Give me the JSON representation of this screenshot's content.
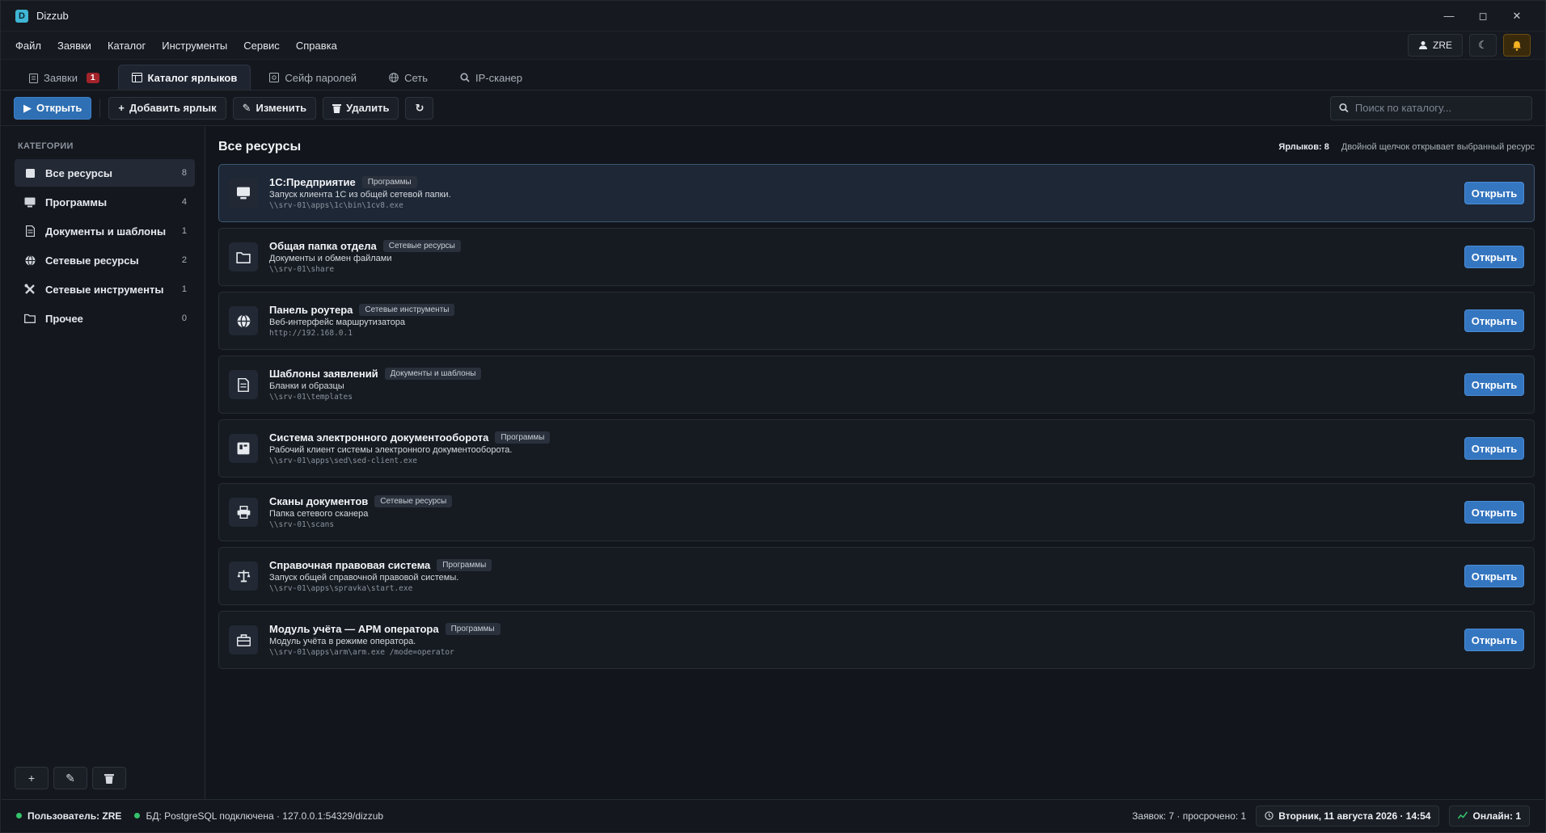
{
  "window": {
    "title": "Dizzub",
    "logo_letter": "D",
    "controls": [
      "—",
      "◻",
      "✕"
    ]
  },
  "menu": [
    "Файл",
    "Заявки",
    "Каталог",
    "Инструменты",
    "Сервис",
    "Справка"
  ],
  "user_chip": "ZRE",
  "tabs": [
    {
      "label": "Заявки",
      "icon": "clipboard-icon",
      "badge": "1"
    },
    {
      "label": "Каталог ярлыков",
      "icon": "catalog-icon",
      "active": true
    },
    {
      "label": "Сейф паролей",
      "icon": "safe-icon"
    },
    {
      "label": "Сеть",
      "icon": "globe-icon"
    },
    {
      "label": "IP-сканер",
      "icon": "search-icon"
    }
  ],
  "toolbar": {
    "open_label": "Открыть",
    "add_label": "Добавить ярлык",
    "edit_label": "Изменить",
    "delete_label": "Удалить",
    "refresh_label": "↻",
    "search_placeholder": "Поиск по каталогу..."
  },
  "sidebar": {
    "heading": "КАТЕГОРИИ",
    "items": [
      {
        "label": "Все ресурсы",
        "count": "8",
        "icon": "square-icon",
        "active": true
      },
      {
        "label": "Программы",
        "count": "4",
        "icon": "monitor-icon"
      },
      {
        "label": "Документы и шаблоны",
        "count": "1",
        "icon": "document-icon"
      },
      {
        "label": "Сетевые ресурсы",
        "count": "2",
        "icon": "globe-icon"
      },
      {
        "label": "Сетевые инструменты",
        "count": "1",
        "icon": "tools-icon"
      },
      {
        "label": "Прочее",
        "count": "0",
        "icon": "folder-icon"
      }
    ]
  },
  "main": {
    "title": "Все ресурсы",
    "count_label": "Ярлыков: 8",
    "hint": "Двойной щелчок открывает выбранный ресурс",
    "open_button_label": "Открыть",
    "items": [
      {
        "title": "1С:Предприятие",
        "category": "Программы",
        "desc": "Запуск клиента 1С из общей сетевой папки.",
        "path": "\\\\srv-01\\apps\\1c\\bin\\1cv8.exe",
        "icon": "monitor-icon",
        "selected": true
      },
      {
        "title": "Общая папка отдела",
        "category": "Сетевые ресурсы",
        "desc": "Документы и обмен файлами",
        "path": "\\\\srv-01\\share",
        "icon": "folder-icon"
      },
      {
        "title": "Панель роутера",
        "category": "Сетевые инструменты",
        "desc": "Веб-интерфейс маршрутизатора",
        "path": "http://192.168.0.1",
        "icon": "globe-icon"
      },
      {
        "title": "Шаблоны заявлений",
        "category": "Документы и шаблоны",
        "desc": "Бланки и образцы",
        "path": "\\\\srv-01\\templates",
        "icon": "document-icon"
      },
      {
        "title": "Система электронного документооборота",
        "category": "Программы",
        "desc": "Рабочий клиент системы электронного документооборота.",
        "path": "\\\\srv-01\\apps\\sed\\sed-client.exe",
        "icon": "inbox-icon"
      },
      {
        "title": "Сканы документов",
        "category": "Сетевые ресурсы",
        "desc": "Папка сетевого сканера",
        "path": "\\\\srv-01\\scans",
        "icon": "printer-icon"
      },
      {
        "title": "Справочная правовая система",
        "category": "Программы",
        "desc": "Запуск общей справочной правовой системы.",
        "path": "\\\\srv-01\\apps\\spravka\\start.exe",
        "icon": "scales-icon"
      },
      {
        "title": "Модуль учёта — АРМ оператора",
        "category": "Программы",
        "desc": "Модуль учёта в режиме оператора.",
        "path": "\\\\srv-01\\apps\\arm\\arm.exe  /mode=operator",
        "icon": "toolbox-icon"
      }
    ]
  },
  "sidebar_actions": [
    "+",
    "✎",
    "🗑"
  ],
  "status": {
    "user": "Пользователь: ZRE",
    "db": "БД: PostgreSQL подключена · 127.0.0.1:54329/dizzub",
    "requests": "Заявок: 7 · просрочено: 1",
    "datetime": "Вторник, 11 августа 2026 · 14:54",
    "online": "Онлайн: 1"
  }
}
